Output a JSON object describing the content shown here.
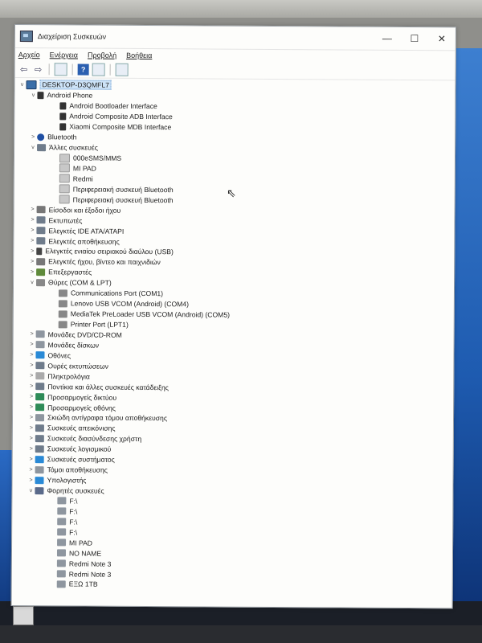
{
  "window": {
    "title": "Διαχείριση Συσκευών",
    "controls": {
      "minimize": "—",
      "maximize": "☐",
      "close": "✕"
    }
  },
  "menu": [
    "Αρχείο",
    "Ενέργεια",
    "Προβολή",
    "Βοήθεια"
  ],
  "toolbar": {
    "back": "⇦",
    "forward": "⇨",
    "help": "?"
  },
  "tree": {
    "root": "DESKTOP-D3QMFL7",
    "items": [
      {
        "label": "Android Phone",
        "level": 1,
        "expander": "v",
        "icon": "phone-icon"
      },
      {
        "label": "Android Bootloader Interface",
        "level": 2,
        "expander": "",
        "icon": "phone-icon"
      },
      {
        "label": "Android Composite ADB Interface",
        "level": 2,
        "expander": "",
        "icon": "phone-icon"
      },
      {
        "label": "Xiaomi Composite MDB Interface",
        "level": 2,
        "expander": "",
        "icon": "phone-icon"
      },
      {
        "label": "Bluetooth",
        "level": 1,
        "expander": ">",
        "icon": "bluetooth-icon"
      },
      {
        "label": "Άλλες συσκευές",
        "level": 1,
        "expander": "v",
        "icon": "other-devices-icon"
      },
      {
        "label": "000eSMS/MMS",
        "level": 2,
        "expander": "",
        "icon": "unknown-device-icon"
      },
      {
        "label": "MI PAD",
        "level": 2,
        "expander": "",
        "icon": "unknown-device-icon"
      },
      {
        "label": "Redmi",
        "level": 2,
        "expander": "",
        "icon": "unknown-device-icon"
      },
      {
        "label": "Περιφερειακή συσκευή Bluetooth",
        "level": 2,
        "expander": "",
        "icon": "unknown-device-icon"
      },
      {
        "label": "Περιφερειακή συσκευή Bluetooth",
        "level": 2,
        "expander": "",
        "icon": "unknown-device-icon"
      },
      {
        "label": "Είσοδοι και έξοδοι ήχου",
        "level": 1,
        "expander": ">",
        "icon": "audio-io-icon"
      },
      {
        "label": "Εκτυπωτές",
        "level": 1,
        "expander": ">",
        "icon": "printer-icon"
      },
      {
        "label": "Ελεγκτές IDE ATA/ATAPI",
        "level": 1,
        "expander": ">",
        "icon": "ide-controller-icon"
      },
      {
        "label": "Ελεγκτές αποθήκευσης",
        "level": 1,
        "expander": ">",
        "icon": "storage-controller-icon"
      },
      {
        "label": "Ελεγκτές ενιαίου σειριακού διαύλου (USB)",
        "level": 1,
        "expander": ">",
        "icon": "usb-icon"
      },
      {
        "label": "Ελεγκτές ήχου, βίντεο και παιχνιδιών",
        "level": 1,
        "expander": ">",
        "icon": "sound-icon"
      },
      {
        "label": "Επεξεργαστές",
        "level": 1,
        "expander": ">",
        "icon": "processor-icon"
      },
      {
        "label": "Θύρες (COM & LPT)",
        "level": 1,
        "expander": "v",
        "icon": "port-icon"
      },
      {
        "label": "Communications Port (COM1)",
        "level": 2,
        "expander": "",
        "icon": "port-icon"
      },
      {
        "label": "Lenovo USB VCOM (Android) (COM4)",
        "level": 2,
        "expander": "",
        "icon": "port-icon"
      },
      {
        "label": "MediaTek PreLoader USB VCOM (Android) (COM5)",
        "level": 2,
        "expander": "",
        "icon": "port-icon"
      },
      {
        "label": "Printer Port (LPT1)",
        "level": 2,
        "expander": "",
        "icon": "port-icon"
      },
      {
        "label": "Μονάδες DVD/CD-ROM",
        "level": 1,
        "expander": ">",
        "icon": "dvd-icon"
      },
      {
        "label": "Μονάδες δίσκων",
        "level": 1,
        "expander": ">",
        "icon": "disk-icon"
      },
      {
        "label": "Οθόνες",
        "level": 1,
        "expander": ">",
        "icon": "monitor-icon"
      },
      {
        "label": "Ουρές εκτυπώσεων",
        "level": 1,
        "expander": ">",
        "icon": "print-queue-icon"
      },
      {
        "label": "Πληκτρολόγια",
        "level": 1,
        "expander": ">",
        "icon": "keyboard-icon"
      },
      {
        "label": "Ποντίκια και άλλες συσκευές κατάδειξης",
        "level": 1,
        "expander": ">",
        "icon": "mouse-icon"
      },
      {
        "label": "Προσαρμογείς δικτύου",
        "level": 1,
        "expander": ">",
        "icon": "network-icon"
      },
      {
        "label": "Προσαρμογείς οθόνης",
        "level": 1,
        "expander": ">",
        "icon": "display-adapter-icon"
      },
      {
        "label": "Σκιώδη αντίγραφα τόμου αποθήκευσης",
        "level": 1,
        "expander": ">",
        "icon": "shadow-copy-icon"
      },
      {
        "label": "Συσκευές απεικόνισης",
        "level": 1,
        "expander": ">",
        "icon": "imaging-icon"
      },
      {
        "label": "Συσκευές διασύνδεσης χρήστη",
        "level": 1,
        "expander": ">",
        "icon": "hid-icon"
      },
      {
        "label": "Συσκευές λογισμικού",
        "level": 1,
        "expander": ">",
        "icon": "software-device-icon"
      },
      {
        "label": "Συσκευές συστήματος",
        "level": 1,
        "expander": ">",
        "icon": "system-device-icon"
      },
      {
        "label": "Τόμοι αποθήκευσης",
        "level": 1,
        "expander": ">",
        "icon": "volume-icon"
      },
      {
        "label": "Υπολογιστής",
        "level": 1,
        "expander": ">",
        "icon": "computer-icon"
      },
      {
        "label": "Φορητές συσκευές",
        "level": 1,
        "expander": "v",
        "icon": "portable-device-icon"
      },
      {
        "label": "F:\\",
        "level": 2,
        "expander": "",
        "icon": "drive-icon"
      },
      {
        "label": "F:\\",
        "level": 2,
        "expander": "",
        "icon": "drive-icon"
      },
      {
        "label": "F:\\",
        "level": 2,
        "expander": "",
        "icon": "drive-icon"
      },
      {
        "label": "F:\\",
        "level": 2,
        "expander": "",
        "icon": "drive-icon"
      },
      {
        "label": "MI PAD",
        "level": 2,
        "expander": "",
        "icon": "drive-icon"
      },
      {
        "label": "NO NAME",
        "level": 2,
        "expander": "",
        "icon": "drive-icon"
      },
      {
        "label": "Redmi Note 3",
        "level": 2,
        "expander": "",
        "icon": "drive-icon"
      },
      {
        "label": "Redmi Note 3",
        "level": 2,
        "expander": "",
        "icon": "drive-icon"
      },
      {
        "label": "ΕΞΩ 1TB",
        "level": 2,
        "expander": "",
        "icon": "drive-icon"
      }
    ]
  }
}
